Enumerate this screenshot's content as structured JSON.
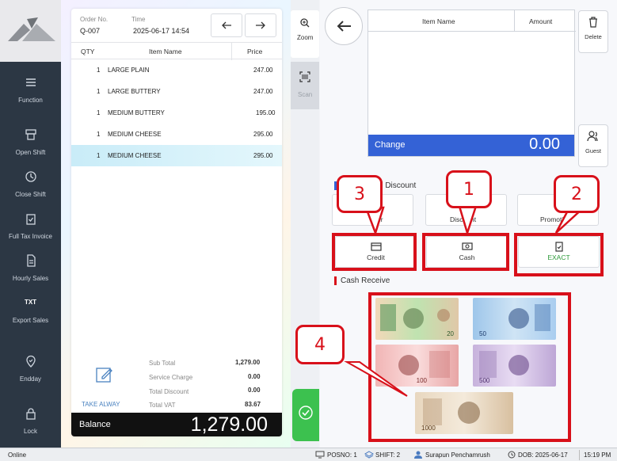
{
  "nav": {
    "items": [
      {
        "label": "Function",
        "icon": "menu-icon"
      },
      {
        "label": "Open Shift",
        "icon": "drawer-icon"
      },
      {
        "label": "Close Shift",
        "icon": "clock-icon"
      },
      {
        "label": "Full Tax Invoice",
        "icon": "clipboard-check-icon"
      },
      {
        "label": "Hourly Sales",
        "icon": "document-icon"
      },
      {
        "label": "Export Sales",
        "icon": "txt-file-icon",
        "icon_text": "TXT"
      },
      {
        "label": "Endday",
        "icon": "location-pin-icon"
      },
      {
        "label": "Lock",
        "icon": "lock-icon"
      }
    ]
  },
  "order": {
    "order_no_label": "Order No.",
    "order_no": "Q-007",
    "time_label": "Time",
    "time": "2025-06-17 14:54",
    "columns": {
      "qty": "QTY",
      "item": "Item Name",
      "price": "Price"
    },
    "rows": [
      {
        "qty": "1",
        "item": "LARGE PLAIN",
        "price": "247.00"
      },
      {
        "qty": "1",
        "item": "LARGE BUTTERY",
        "price": "247.00"
      },
      {
        "qty": "1",
        "item": "MEDIUM BUTTERY",
        "price": "195.00"
      },
      {
        "qty": "1",
        "item": "MEDIUM CHEESE",
        "price": "295.00"
      },
      {
        "qty": "1",
        "item": "MEDIUM CHEESE",
        "price": "295.00"
      }
    ],
    "take_away": "TAKE ALWAY",
    "totals": {
      "sub_total_label": "Sub Total",
      "sub_total": "1,279.00",
      "service_label": "Service Charge",
      "service": "0.00",
      "discount_label": "Total Discount",
      "discount": "0.00",
      "vat_label": "Total VAT",
      "vat": "83.67"
    },
    "balance_label": "Balance",
    "balance": "1,279.00"
  },
  "strip": {
    "zoom_label": "Zoom",
    "scan_label": "Scan"
  },
  "right": {
    "table_headers": {
      "item": "Item Name",
      "amount": "Amount"
    },
    "change_label": "Change",
    "change_value": "0.00",
    "delete_label": "Delete",
    "guest_label": "Guest",
    "discount_section": "d Discount",
    "discount_buttons": [
      "er",
      "Discount",
      "Promotio"
    ],
    "payment_buttons": [
      {
        "label": "Credit",
        "icon": "credit-card-icon"
      },
      {
        "label": "Cash",
        "icon": "cash-icon"
      },
      {
        "label": "EXACT",
        "icon": "exact-icon"
      }
    ],
    "cash_receive_label": "Cash Receive",
    "banknotes": [
      "20",
      "50",
      "100",
      "500",
      "1000"
    ],
    "callouts": [
      "1",
      "2",
      "3",
      "4"
    ]
  },
  "colors": {
    "nav_bg": "#2c3744",
    "change_bar": "#3462d6",
    "highlight": "#d8101a",
    "confirm": "#3cc14f",
    "exact_text": "#2e9a3a"
  },
  "status": {
    "online": "Online",
    "posno": "POSNO: 1",
    "shift": "SHIFT: 2",
    "user": "Surapun Penchamrush",
    "dob": "DOB: 2025-06-17",
    "time": "15:19 PM"
  }
}
